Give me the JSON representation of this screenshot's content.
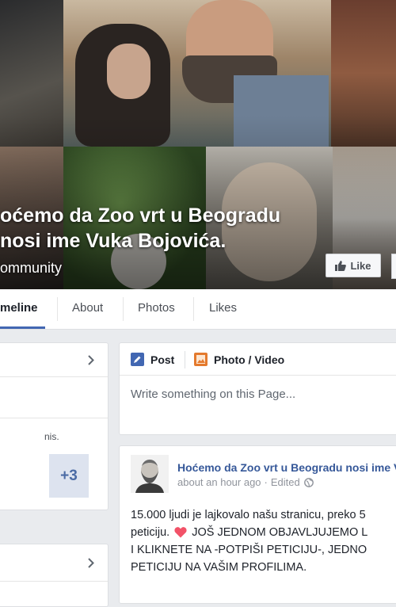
{
  "page": {
    "name_line1": "oćemo da Zoo vrt u Beogradu",
    "name_line2": "nosi ime Vuka Bojovića.",
    "category": "ommunity",
    "like_button": "Like"
  },
  "nav": {
    "tabs": [
      {
        "label": "meline"
      },
      {
        "label": "About"
      },
      {
        "label": "Photos"
      },
      {
        "label": "Likes"
      }
    ]
  },
  "sidebar": {
    "snippet": "nis.",
    "more_badge": "+3"
  },
  "composer": {
    "tab_post": "Post",
    "tab_photo": "Photo / Video",
    "placeholder": "Write something on this Page..."
  },
  "post": {
    "author": "Hoćemo da Zoo vrt u Beogradu nosi ime V",
    "time": "about an hour ago",
    "dot": "·",
    "edited": "Edited",
    "line1": "15.000 ljudi je lajkovalo našu stranicu, preko 5",
    "line2_text": "peticiju.",
    "line2_rest": "JOŠ JEDNOM OBJAVLJUJEMO L",
    "line3": "I KLIKNETE NA -POTPIŠI PETICIJU-, JEDNO",
    "line4": "PETICIJU NA VAŠIM PROFILIMA."
  },
  "colors": {
    "link": "#365899",
    "accent": "#4267b2",
    "heart": "#f25268"
  }
}
